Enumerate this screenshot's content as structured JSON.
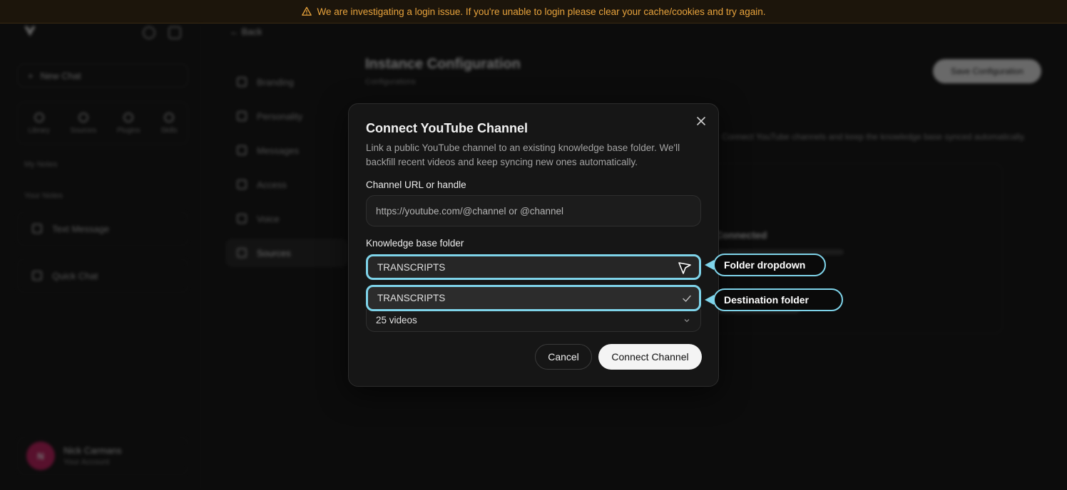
{
  "banner": {
    "text": "We are investigating a login issue. If you're unable to login please clear your cache/cookies and try again.",
    "color": "#e8a33c",
    "icon": "warning-icon"
  },
  "sidebar": {
    "new_chat": "New Chat",
    "quick": [
      "Library",
      "Sources",
      "Plugins",
      "Skills"
    ],
    "section_label": "My Notes",
    "section2_label": "Your Notes",
    "rows": [
      "Text Message",
      "Quick Chat"
    ],
    "user": {
      "initials": "N",
      "name": "Nick Carmans",
      "sub": "Your Account"
    }
  },
  "settings_nav": {
    "back": "Back",
    "items": [
      "Branding",
      "Personality",
      "Messages",
      "Access",
      "Voice",
      "Sources"
    ],
    "active": "Sources"
  },
  "main": {
    "title": "Instance Configuration",
    "subtitle": "Configurations",
    "save_button": "Save Configuration",
    "description": "Connect YouTube channels and keep the knowledge base synced automatically.",
    "panel_title": "Connected"
  },
  "modal": {
    "title": "Connect YouTube Channel",
    "description": "Link a public YouTube channel to an existing knowledge base folder. We'll backfill recent videos and keep syncing new ones automatically.",
    "channel_label": "Channel URL or handle",
    "channel_placeholder": "https://youtube.com/@channel or @channel",
    "folder_label": "Knowledge base folder",
    "folder_selected": "TRANSCRIPTS",
    "folder_option": "TRANSCRIPTS",
    "videos_value": "25 videos",
    "cancel": "Cancel",
    "connect": "Connect Channel"
  },
  "callouts": {
    "folder_dropdown": "Folder dropdown",
    "destination_folder": "Destination folder",
    "color": "#7fd4ea"
  }
}
